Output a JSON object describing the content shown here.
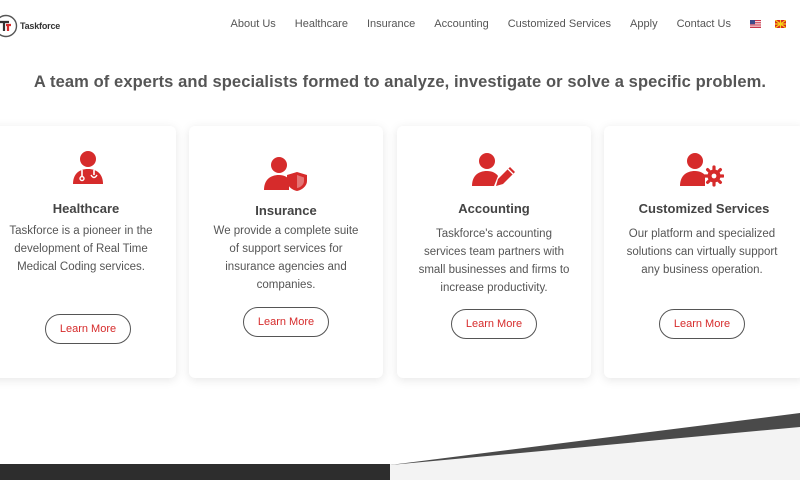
{
  "brand": {
    "name": "Taskforce",
    "accent": "#d62b2b"
  },
  "nav": {
    "items": [
      "About Us",
      "Healthcare",
      "Insurance",
      "Accounting",
      "Customized Services",
      "Apply",
      "Contact Us"
    ],
    "flags": [
      "us-flag-icon",
      "mk-flag-icon"
    ]
  },
  "hero": {
    "tagline": "A team of experts and specialists formed to analyze, investigate or solve a specific problem."
  },
  "services": [
    {
      "title": "Healthcare",
      "icon": "doctor-icon",
      "description": "Taskforce is a pioneer in the development of Real Time Medical Coding services.",
      "button": "Learn More"
    },
    {
      "title": "Insurance",
      "icon": "user-shield-icon",
      "description": "We provide a complete suite of support services for insurance agencies and companies.",
      "button": "Learn More"
    },
    {
      "title": "Accounting",
      "icon": "user-edit-icon",
      "description": "Taskforce's accounting services team partners with small businesses and firms to increase productivity.",
      "button": "Learn More"
    },
    {
      "title": "Customized Services",
      "icon": "user-cog-icon",
      "description": "Our platform and specialized solutions can virtually support any business operation.",
      "button": "Learn More"
    }
  ]
}
